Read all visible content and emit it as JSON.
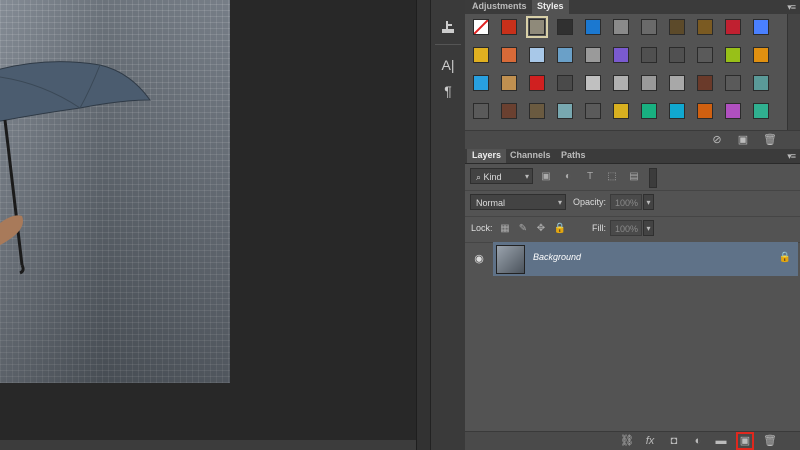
{
  "panels": {
    "top_tabs": [
      "Adjustments",
      "Styles"
    ],
    "active_top_tab": "Styles",
    "layers_tabs": [
      "Layers",
      "Channels",
      "Paths"
    ],
    "active_layers_tab": "Layers"
  },
  "styles": {
    "swatch_colors": [
      [
        "#ffffff",
        "#c8301a",
        "#8f8a7a",
        "#303030",
        "#1b78d0",
        "#8a8a8a",
        "#6a6a6a",
        "#5c4a2a",
        "#7a5a22",
        "#c02030",
        "#4a80ff"
      ],
      [
        "#e0b020",
        "#d86a38",
        "#a8c8e8",
        "#6aa0c8",
        "#9a9a9a",
        "#7a5ad0",
        "#505050",
        "#505050",
        "#5a5a5a",
        "#98c018",
        "#e09010"
      ],
      [
        "#28a0e0",
        "#c09050",
        "#d02020",
        "#4a4a4a",
        "#c0c0c0",
        "#b0b0b0",
        "#9a9a9a",
        "#a8a8a8",
        "#6a3a2a",
        "#5a5a5a",
        "#5a9a98"
      ],
      [
        "#5a5a5a",
        "#6a4030",
        "#6a5a40",
        "#78a8b0",
        "#5a5a5a",
        "#d8b020",
        "#18b080",
        "#10a8d0",
        "#d06010",
        "#b050c0",
        "#30b090"
      ]
    ]
  },
  "layers": {
    "filter_kind": "Kind",
    "blend_mode": "Normal",
    "opacity_label": "Opacity:",
    "opacity_value": "100%",
    "lock_label": "Lock:",
    "fill_label": "Fill:",
    "fill_value": "100%",
    "items": [
      {
        "name": "Background",
        "locked": true,
        "visible": true
      }
    ]
  },
  "colors": {
    "highlight": "#e0281e",
    "layer_selected": "#5f7288"
  }
}
